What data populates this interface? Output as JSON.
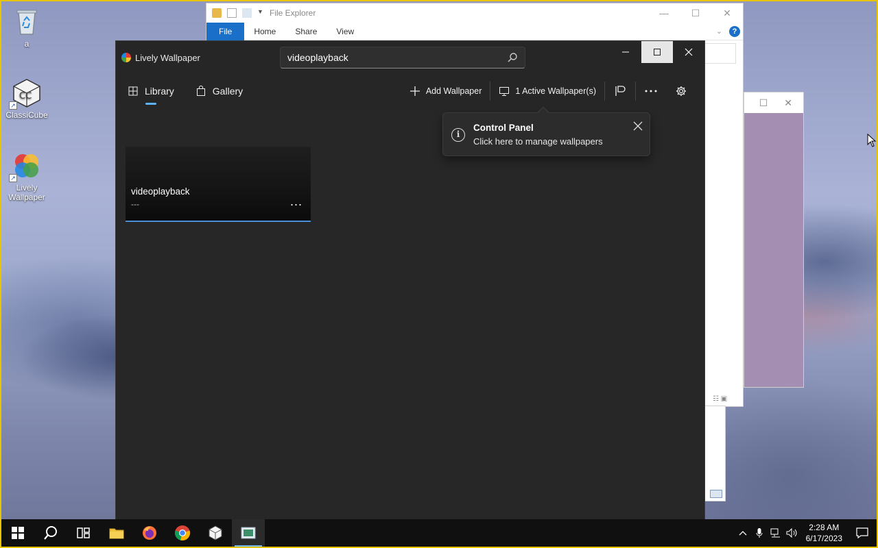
{
  "desktop": {
    "icons": [
      {
        "label": "a"
      },
      {
        "label": "ClassiCube"
      },
      {
        "label": "Lively Wallpaper"
      }
    ]
  },
  "explorer": {
    "title": "File Explorer",
    "tabs": [
      "File",
      "Home",
      "Share",
      "View"
    ],
    "help": "?"
  },
  "lively": {
    "app_name": "Lively Wallpaper",
    "search": {
      "value": "videoplayback",
      "placeholder": "Search"
    },
    "nav": {
      "library": "Library",
      "gallery": "Gallery"
    },
    "actions": {
      "add_wallpaper": "Add Wallpaper",
      "active_wallpapers": "1 Active Wallpaper(s)"
    },
    "card": {
      "title": "videoplayback",
      "subtitle": "---",
      "more": "..."
    },
    "tooltip": {
      "title": "Control Panel",
      "message": "Click here to manage wallpapers",
      "info": "i"
    }
  },
  "taskbar": {
    "time": "2:28 AM",
    "date": "6/17/2023"
  },
  "colors": {
    "accent": "#5fb2f2",
    "explorer_file_tab": "#1a6fc9",
    "app_bg": "#262626",
    "taskbar": "#101010"
  }
}
